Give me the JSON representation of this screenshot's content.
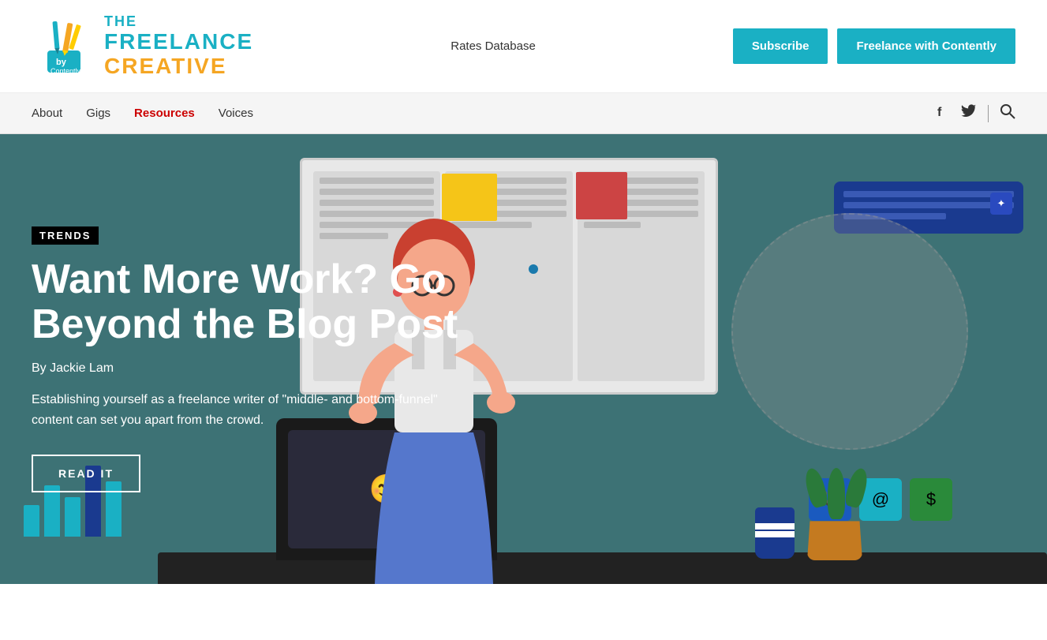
{
  "header": {
    "logo": {
      "the": "THE",
      "freelance": "FREELANCE",
      "creative": "CREATIVE",
      "byContently": "by Contently"
    },
    "nav": {
      "rates_db": "Rates Database"
    },
    "buttons": {
      "subscribe": "Subscribe",
      "freelance_with": "Freelance with Contently"
    }
  },
  "navbar": {
    "links": [
      {
        "label": "About",
        "class": "about"
      },
      {
        "label": "Gigs",
        "class": "gigs"
      },
      {
        "label": "Resources",
        "class": "resources"
      },
      {
        "label": "Voices",
        "class": "voices"
      }
    ],
    "social": {
      "facebook": "f",
      "twitter": "t",
      "search": "🔍"
    }
  },
  "hero": {
    "category": "TRENDS",
    "title": "Want More Work? Go Beyond the Blog Post",
    "author": "By Jackie Lam",
    "description": "Establishing yourself as a freelance writer of \"middle- and bottom-funnel\" content can set you apart from the crowd.",
    "read_btn": "READ IT"
  },
  "colors": {
    "teal": "#1ab0c4",
    "orange": "#f5a623",
    "dark_teal": "#3d7275",
    "dark_blue": "#1a3a8f"
  }
}
